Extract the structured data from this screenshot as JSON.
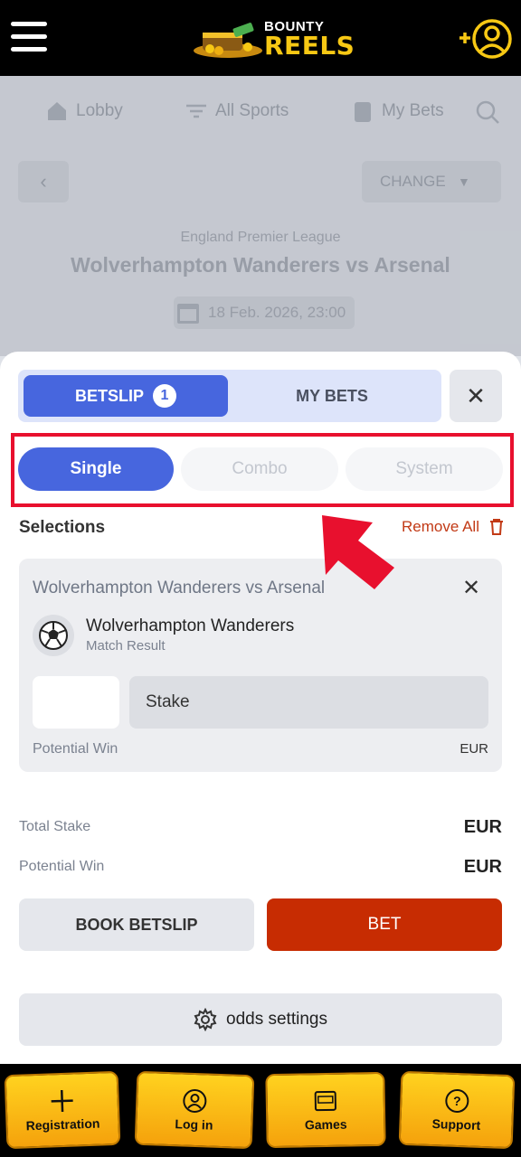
{
  "header": {
    "logo_word1": "BOUNTY",
    "logo_word2": "REELS",
    "icons": [
      "menu-icon",
      "user-add-icon"
    ]
  },
  "background_page": {
    "nav": [
      {
        "label": "Lobby",
        "icon": "home-icon"
      },
      {
        "label": "All Sports",
        "icon": "filter-icon"
      },
      {
        "label": "My Bets",
        "icon": "clipboard-icon"
      }
    ],
    "change_label": "CHANGE",
    "league": "England Premier League",
    "match": "Wolverhampton Wanderers vs Arsenal",
    "date": "18 Feb. 2026, 23:00"
  },
  "betslip": {
    "tab_betslip": "BETSLIP",
    "badge_count": "1",
    "tab_mybets": "MY BETS",
    "close_symbol": "✕",
    "types": [
      "Single",
      "Combo",
      "System"
    ],
    "selected_type": "Single",
    "selections_label": "Selections",
    "remove_all": "Remove All",
    "selection": {
      "match": "Wolverhampton Wanderers vs Arsenal",
      "team": "Wolverhampton Wanderers",
      "market": "Match Result",
      "stake_placeholder": "Stake",
      "potential_win_label": "Potential Win",
      "currency": "EUR"
    },
    "total_stake_label": "Total Stake",
    "total_stake_currency": "EUR",
    "potential_win_label": "Potential Win",
    "potential_win_currency": "EUR",
    "book_betslip": "BOOK BETSLIP",
    "bet": "BET",
    "odds_settings": "odds settings"
  },
  "bottom_nav": [
    {
      "label": "Registration",
      "icon": "plus-icon"
    },
    {
      "label": "Log in",
      "icon": "user-icon"
    },
    {
      "label": "Games",
      "icon": "slot-machine-icon"
    },
    {
      "label": "Support",
      "icon": "help-icon"
    }
  ],
  "colors": {
    "primary": "#4766de",
    "bet": "#c72c02",
    "highlight": "#e8102e",
    "gold": "#f7c814"
  }
}
